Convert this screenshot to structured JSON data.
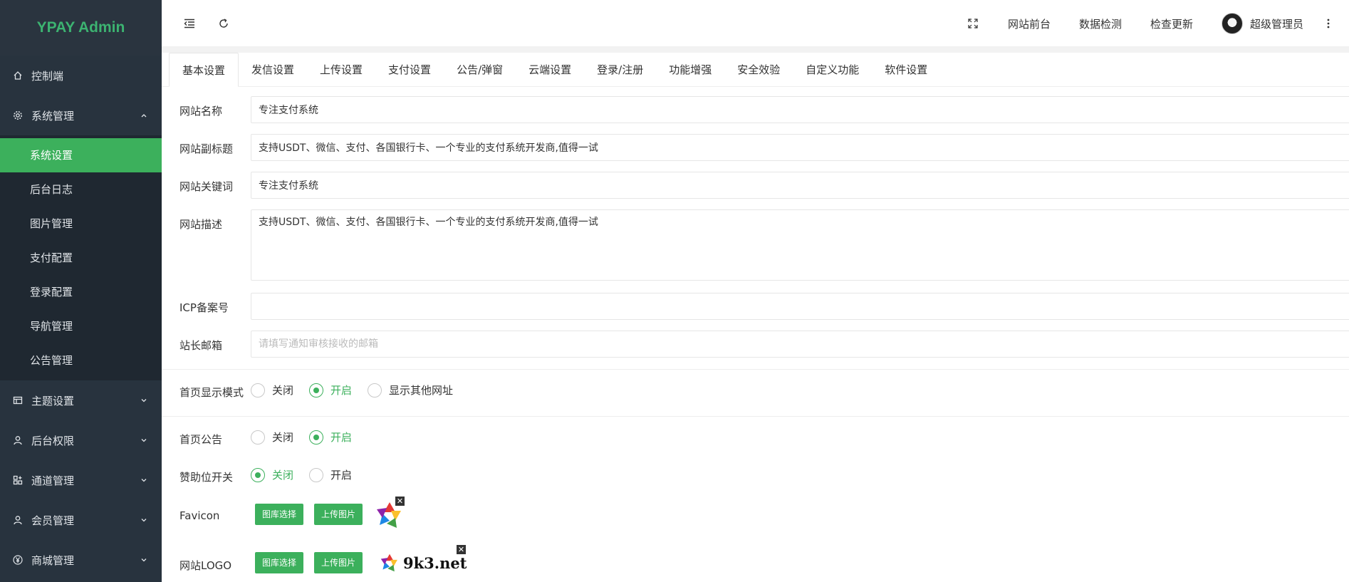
{
  "app": {
    "title": "YPAY Admin"
  },
  "sidebar": {
    "items": [
      {
        "label": "控制端",
        "icon": "home-icon"
      },
      {
        "label": "系统管理",
        "icon": "gear-icon",
        "expanded": true,
        "children": [
          "系统设置",
          "后台日志",
          "图片管理",
          "支付配置",
          "登录配置",
          "导航管理",
          "公告管理"
        ],
        "active_child": "系统设置"
      },
      {
        "label": "主题设置",
        "icon": "layout-icon"
      },
      {
        "label": "后台权限",
        "icon": "user-icon"
      },
      {
        "label": "通道管理",
        "icon": "apps-icon"
      },
      {
        "label": "会员管理",
        "icon": "user-icon"
      },
      {
        "label": "商城管理",
        "icon": "yen-icon"
      }
    ]
  },
  "header": {
    "links": [
      "网站前台",
      "数据检测",
      "检查更新"
    ],
    "user_name": "超级管理员"
  },
  "tabs": [
    "基本设置",
    "发信设置",
    "上传设置",
    "支付设置",
    "公告/弹窗",
    "云端设置",
    "登录/注册",
    "功能增强",
    "安全效验",
    "自定义功能",
    "软件设置"
  ],
  "active_tab": "基本设置",
  "form": {
    "site_name": {
      "label": "网站名称",
      "value": "专注支付系统"
    },
    "site_subtitle": {
      "label": "网站副标题",
      "value": "支持USDT、微信、支付、各国银行卡、一个专业的支付系统开发商,值得一试"
    },
    "site_keywords": {
      "label": "网站关键词",
      "value": "专注支付系统"
    },
    "site_description": {
      "label": "网站描述",
      "value": "支持USDT、微信、支付、各国银行卡、一个专业的支付系统开发商,值得一试"
    },
    "icp": {
      "label": "ICP备案号",
      "value": ""
    },
    "admin_email": {
      "label": "站长邮箱",
      "value": "",
      "placeholder": "请填写通知审核接收的邮箱"
    },
    "home_mode": {
      "label": "首页显示模式",
      "options": [
        "关闭",
        "开启",
        "显示其他网址"
      ],
      "selected": "开启"
    },
    "home_notice": {
      "label": "首页公告",
      "options": [
        "关闭",
        "开启"
      ],
      "selected": "开启"
    },
    "sponsor": {
      "label": "赞助位开关",
      "options": [
        "关闭",
        "开启"
      ],
      "selected": "关闭"
    },
    "favicon": {
      "label": "Favicon",
      "btn_library": "图库选择",
      "btn_upload": "上传图片"
    },
    "site_logo": {
      "label": "网站LOGO",
      "btn_library": "图库选择",
      "btn_upload": "上传图片",
      "logo_text": "9k3.net"
    }
  },
  "colors": {
    "accent": "#3cb05c",
    "sidebar_bg": "#28333e",
    "logo_green": "#3cb371"
  }
}
